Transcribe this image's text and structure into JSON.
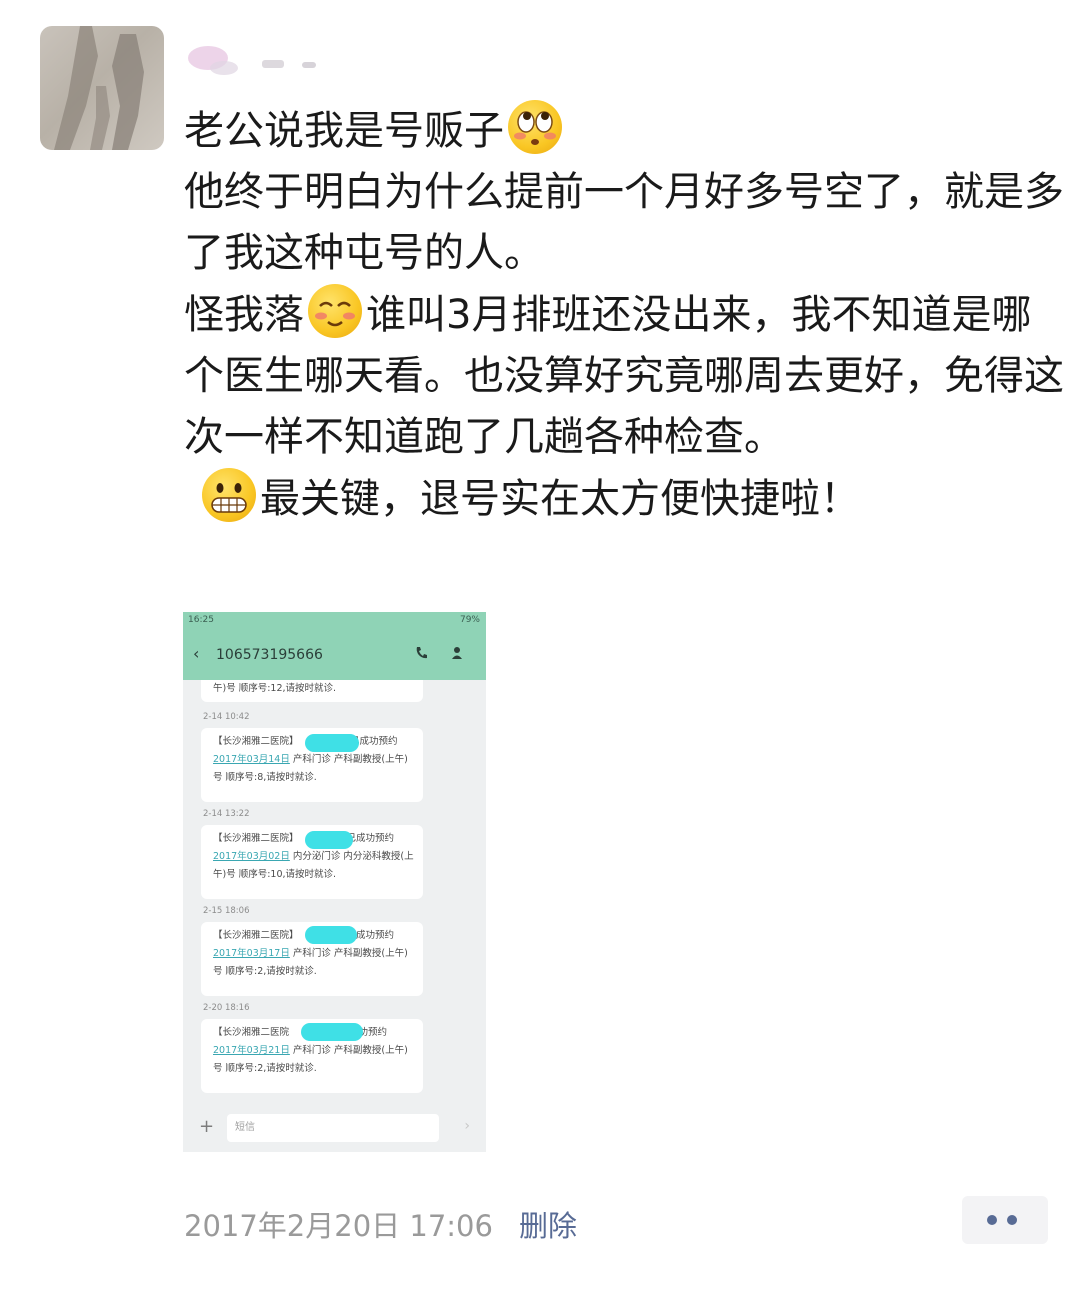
{
  "post": {
    "lines": [
      "老公说我是号贩子",
      "他终于明白为什么提前一个月好多号空了，就是多了我这种屯号的人。",
      "怪我落",
      "谁叫3月排班还没出来，我不知道是哪个医生哪天看。也没算好究竟哪周去更好，免得这次一样不知道跑了几趟各种检查。",
      "最关键，退号实在太方便快捷啦！"
    ],
    "emojis": [
      "eye-roll-emoji",
      "blushing-smile-emoji",
      "grimacing-emoji"
    ]
  },
  "screenshot": {
    "status_time": "16:25",
    "battery": "79%",
    "sender_number": "10657319566​6",
    "partial_message": "午)号  顺序号:12,请按时就诊.",
    "messages": [
      {
        "timestamp": "2-14 10:42",
        "prefix": "【长沙湘雅二医院】",
        "status": "您已成功预约",
        "date": "2017年03月14日",
        "detail": "产科门诊 产科副教授(上午)号  顺序号:8,请按时就诊."
      },
      {
        "timestamp": "2-14 13:22",
        "prefix": "【长沙湘雅二医院】",
        "status": "已成功预约",
        "date": "2017年03月02日",
        "detail": "内分泌门诊 内分泌科教授(上午)号  顺序号:10,请按时就诊."
      },
      {
        "timestamp": "2-15 18:06",
        "prefix": "【长沙湘雅二医院】",
        "status": "已成功预约",
        "date": "2017年03月17日",
        "detail": "产科门诊 产科副教授(上午)号  顺序号:2,请按时就诊."
      },
      {
        "timestamp": "2-20 18:16",
        "prefix": "【长沙湘雅二医院",
        "status": "成功预约",
        "date": "2017年03月21日",
        "detail": "产科门诊 产科副教授(上午)号  顺序号:2,请按时就诊."
      }
    ],
    "input_placeholder": "短信"
  },
  "footer": {
    "timestamp": "2017年2月20日 17:06",
    "delete_label": "删除"
  },
  "colors": {
    "delete_link": "#586b95",
    "sms_header": "#8fd3b6",
    "redaction": "#3fe0e6",
    "date_link": "#3aa7b2"
  }
}
